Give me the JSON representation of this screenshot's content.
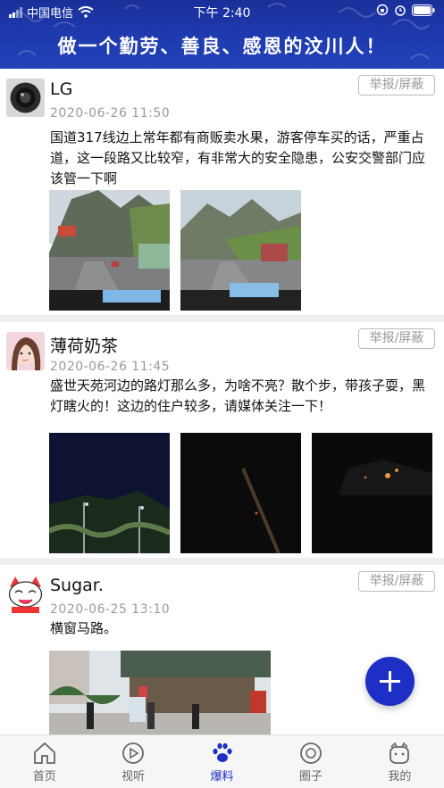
{
  "status_bar": {
    "carrier": "中国电信",
    "time": "下午 2:40"
  },
  "header": {
    "slogan": "做一个勤劳、善良、感恩的汶川人！"
  },
  "report_label": "举报/屏蔽",
  "posts": [
    {
      "user": "LG",
      "time": "2020-06-26 11:50",
      "text": "国道317线边上常年都有商贩卖水果，游客停车买的话，严重占道，这一段路又比较窄，有非常大的安全隐患，公安交警部门应该管一下啊"
    },
    {
      "user": "薄荷奶茶",
      "time": "2020-06-26 11:45",
      "text": "盛世天苑河边的路灯那么多，为啥不亮？散个步，带孩子耍，黑灯瞎火的！这边的住户较多，请媒体关注一下！"
    },
    {
      "user": "Sugar.",
      "time": "2020-06-25 13:10",
      "text": "横窗马路。"
    }
  ],
  "tabs": [
    {
      "label": "首页",
      "icon": "home-icon",
      "active": false
    },
    {
      "label": "视听",
      "icon": "play-icon",
      "active": false
    },
    {
      "label": "爆料",
      "icon": "paw-icon",
      "active": true
    },
    {
      "label": "圈子",
      "icon": "circle-icon",
      "active": false
    },
    {
      "label": "我的",
      "icon": "profile-icon",
      "active": false
    }
  ],
  "colors": {
    "header": "#1f3bb0",
    "accent": "#1d2fc4",
    "fab": "#1d2fc4"
  }
}
